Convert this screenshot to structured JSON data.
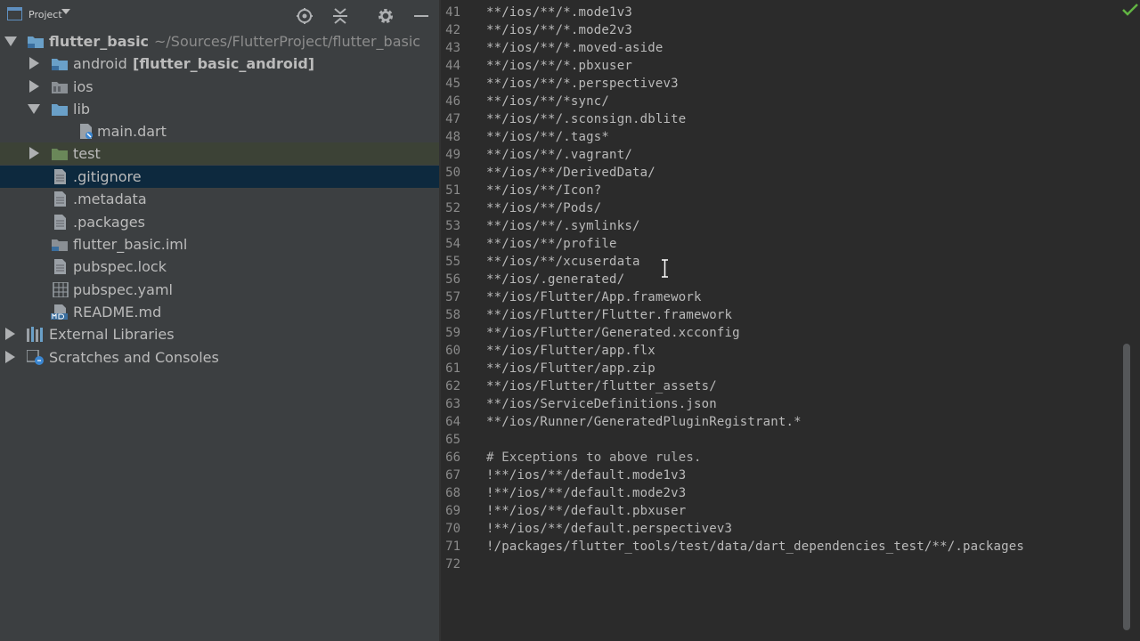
{
  "toolbar": {
    "project_label": "Project",
    "icons": [
      "project-view-icon",
      "dropdown-arrow-icon",
      "locate-icon",
      "collapse-all-icon",
      "settings-gear-icon",
      "hide-minus-icon"
    ]
  },
  "tree": {
    "root": {
      "name": "flutter_basic",
      "path": "~/Sources/FlutterProject/flutter_basic"
    },
    "items": [
      {
        "label": "android",
        "module": "[flutter_basic_android]"
      },
      {
        "label": "ios"
      },
      {
        "label": "lib"
      },
      {
        "label": "main.dart"
      },
      {
        "label": "test"
      },
      {
        "label": ".gitignore"
      },
      {
        "label": ".metadata"
      },
      {
        "label": ".packages"
      },
      {
        "label": "flutter_basic.iml"
      },
      {
        "label": "pubspec.lock"
      },
      {
        "label": "pubspec.yaml"
      },
      {
        "label": "README.md"
      },
      {
        "label": "External Libraries"
      },
      {
        "label": "Scratches and Consoles"
      }
    ]
  },
  "editor": {
    "lines": [
      {
        "n": "41",
        "text": "**/ios/**/*.mode1v3"
      },
      {
        "n": "42",
        "text": "**/ios/**/*.mode2v3"
      },
      {
        "n": "43",
        "text": "**/ios/**/*.moved-aside"
      },
      {
        "n": "44",
        "text": "**/ios/**/*.pbxuser"
      },
      {
        "n": "45",
        "text": "**/ios/**/*.perspectivev3"
      },
      {
        "n": "46",
        "text": "**/ios/**/*sync/"
      },
      {
        "n": "47",
        "text": "**/ios/**/.sconsign.dblite"
      },
      {
        "n": "48",
        "text": "**/ios/**/.tags*"
      },
      {
        "n": "49",
        "text": "**/ios/**/.vagrant/"
      },
      {
        "n": "50",
        "text": "**/ios/**/DerivedData/"
      },
      {
        "n": "51",
        "text": "**/ios/**/Icon?"
      },
      {
        "n": "52",
        "text": "**/ios/**/Pods/"
      },
      {
        "n": "53",
        "text": "**/ios/**/.symlinks/"
      },
      {
        "n": "54",
        "text": "**/ios/**/profile"
      },
      {
        "n": "55",
        "text": "**/ios/**/xcuserdata"
      },
      {
        "n": "56",
        "text": "**/ios/.generated/"
      },
      {
        "n": "57",
        "text": "**/ios/Flutter/App.framework"
      },
      {
        "n": "58",
        "text": "**/ios/Flutter/Flutter.framework"
      },
      {
        "n": "59",
        "text": "**/ios/Flutter/Generated.xcconfig"
      },
      {
        "n": "60",
        "text": "**/ios/Flutter/app.flx"
      },
      {
        "n": "61",
        "text": "**/ios/Flutter/app.zip"
      },
      {
        "n": "62",
        "text": "**/ios/Flutter/flutter_assets/"
      },
      {
        "n": "63",
        "text": "**/ios/ServiceDefinitions.json"
      },
      {
        "n": "64",
        "text": "**/ios/Runner/GeneratedPluginRegistrant.*"
      },
      {
        "n": "65",
        "text": ""
      },
      {
        "n": "66",
        "text": "# Exceptions to above rules."
      },
      {
        "n": "67",
        "text": "!**/ios/**/default.mode1v3"
      },
      {
        "n": "68",
        "text": "!**/ios/**/default.mode2v3"
      },
      {
        "n": "69",
        "text": "!**/ios/**/default.pbxuser"
      },
      {
        "n": "70",
        "text": "!**/ios/**/default.perspectivev3"
      },
      {
        "n": "71",
        "text": "!/packages/flutter_tools/test/data/dart_dependencies_test/**/.packages"
      },
      {
        "n": "72",
        "text": ""
      }
    ]
  },
  "colors": {
    "sidebar_bg": "#3c3f41",
    "editor_bg": "#2b2b2b",
    "selection": "#0d293e",
    "folder_blue": "#6aa0c8",
    "check_green": "#62b543"
  }
}
